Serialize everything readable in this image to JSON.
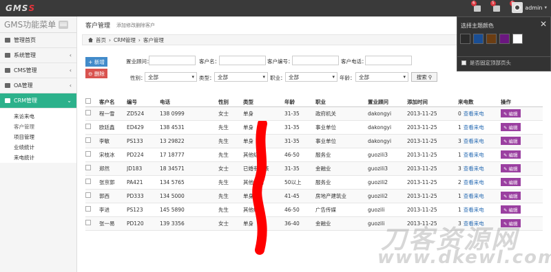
{
  "app": {
    "logo_left": "GMS",
    "logo_right": "S",
    "sidebar_title": "GMS功能菜单"
  },
  "topbar": {
    "badges": [
      "6",
      "5",
      "5"
    ],
    "user": "admin"
  },
  "sidebar": {
    "items": [
      {
        "label": "管理首页",
        "chevron": ""
      },
      {
        "label": "系统管理",
        "chevron": "‹"
      },
      {
        "label": "CMS管理",
        "chevron": "‹"
      },
      {
        "label": "OA管理",
        "chevron": "‹"
      },
      {
        "label": "CRM管理",
        "chevron": "⌄"
      }
    ],
    "sub_items": [
      "来访来电",
      "客户管理",
      "项目管理",
      "业绩统计",
      "来电统计"
    ]
  },
  "page": {
    "title": "客户管理",
    "subtitle": "添加修改删除客户"
  },
  "breadcrumb": {
    "home": "首页",
    "sep1": "›",
    "level2": "CRM管理",
    "sep2": "›",
    "level3": "客户管理"
  },
  "buttons": {
    "add": "+ 新增",
    "delete": "⊖ 删除",
    "search": "搜索"
  },
  "filters": {
    "consultant_label": "置业顾问：",
    "customer_label": "客户名：",
    "code_label": "客户编号：",
    "phone_label": "客户电话：",
    "gender_label": "性别：",
    "type_label": "类型：",
    "job_label": "职业：",
    "age_label": "年龄：",
    "all": "全部"
  },
  "table": {
    "headers": [
      "客户名",
      "编号",
      "电话",
      "性别",
      "类型",
      "年龄",
      "职业",
      "置业顾问",
      "添加时间",
      "来电数",
      "操作"
    ],
    "rows": [
      {
        "name": "程一雪",
        "code": "ZD524",
        "phone": "138    0999",
        "gender": "女士",
        "type": "单身",
        "age": "31-35",
        "job": "政府机关",
        "agent": "dakongyi",
        "date": "2013-11-25",
        "calls": "0",
        "view": "查看来电",
        "edit": "编辑"
      },
      {
        "name": "欧廷鑫",
        "code": "ED429",
        "phone": "138    4531",
        "gender": "先生",
        "type": "单身",
        "age": "31-35",
        "job": "事业单位",
        "agent": "dakongyi",
        "date": "2013-11-25",
        "calls": "1",
        "view": "查看来电",
        "edit": "编辑"
      },
      {
        "name": "李敏",
        "code": "PS133",
        "phone": "13    29822",
        "gender": "先生",
        "type": "单身",
        "age": "31-35",
        "job": "事业单位",
        "agent": "dakongyi",
        "date": "2013-11-25",
        "calls": "3",
        "view": "查看来电",
        "edit": "编辑"
      },
      {
        "name": "宋枝冰",
        "code": "PD224",
        "phone": "17    18777",
        "gender": "先生",
        "type": "其他结构",
        "age": "46-50",
        "job": "服务业",
        "agent": "guozili3",
        "date": "2013-11-25",
        "calls": "1",
        "view": "查看来电",
        "edit": "编辑"
      },
      {
        "name": "郑然",
        "code": "JD183",
        "phone": "18    34571",
        "gender": "女士",
        "type": "已婚有小孩",
        "age": "31-35",
        "job": "金融业",
        "agent": "guozili3",
        "date": "2013-11-25",
        "calls": "3",
        "view": "查看来电",
        "edit": "编辑"
      },
      {
        "name": "张京郭",
        "code": "PA421",
        "phone": "134    5765",
        "gender": "先生",
        "type": "其他结构",
        "age": "50以上",
        "job": "服务业",
        "agent": "guozili2",
        "date": "2013-11-25",
        "calls": "2",
        "view": "查看来电",
        "edit": "编辑"
      },
      {
        "name": "郭西",
        "code": "PD333",
        "phone": "134    5000",
        "gender": "先生",
        "type": "单身",
        "age": "41-45",
        "job": "房地产建筑业",
        "agent": "guozili2",
        "date": "2013-11-25",
        "calls": "1",
        "view": "查看来电",
        "edit": "编辑"
      },
      {
        "name": "李进",
        "code": "PS123",
        "phone": "145    5890",
        "gender": "先生",
        "type": "其他结构",
        "age": "46-50",
        "job": "广告传媒",
        "agent": "guozili",
        "date": "2013-11-25",
        "calls": "1",
        "view": "查看来电",
        "edit": "编辑"
      },
      {
        "name": "张一易",
        "code": "PD120",
        "phone": "139    3356",
        "gender": "女士",
        "type": "单身",
        "age": "36-40",
        "job": "金融业",
        "agent": "guozili",
        "date": "2013-11-25",
        "calls": "3",
        "view": "查看来电",
        "edit": "编辑"
      }
    ]
  },
  "theme_panel": {
    "title": "选择主题颜色",
    "close": "✕",
    "swatches": [
      "#2b2b2b",
      "#1a4e94",
      "#6b3d12",
      "#6b1780",
      "#ffffff"
    ],
    "fixed_header": "是否固定顶部页头"
  },
  "watermark": {
    "line1": "刀客资源网",
    "line2": "www.dkewl.com"
  }
}
